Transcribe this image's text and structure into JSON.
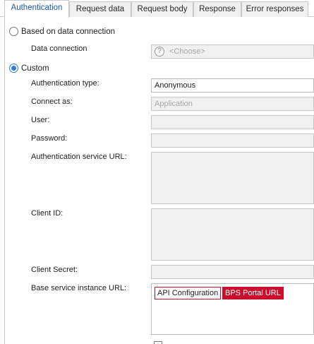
{
  "tabs": [
    {
      "label": "Authentication",
      "active": true
    },
    {
      "label": "Request data",
      "active": false
    },
    {
      "label": "Request body",
      "active": false
    },
    {
      "label": "Response",
      "active": false
    },
    {
      "label": "Error responses",
      "active": false
    }
  ],
  "source": {
    "based_on_connection_label": "Based on data connection",
    "based_on_connection_checked": false,
    "data_connection_label": "Data connection",
    "data_connection_placeholder": "<Choose>",
    "custom_label": "Custom",
    "custom_checked": true
  },
  "form": {
    "auth_type_label": "Authentication type:",
    "auth_type_value": "Anonymous",
    "connect_as_label": "Connect as:",
    "connect_as_value": "Application",
    "user_label": "User:",
    "user_value": "",
    "password_label": "Password:",
    "password_value": "",
    "auth_service_url_label": "Authentication service URL:",
    "auth_service_url_value": "",
    "client_id_label": "Client ID:",
    "client_id_value": "",
    "client_secret_label": "Client Secret:",
    "client_secret_value": "",
    "base_url_label": "Base service instance URL:",
    "base_url_tokens": [
      "API Configuration",
      "BPS Portal URL"
    ]
  },
  "colors": {
    "accent": "#2f7bd6",
    "token": "#c8102e",
    "disabled_field": "#f0f0f0"
  }
}
